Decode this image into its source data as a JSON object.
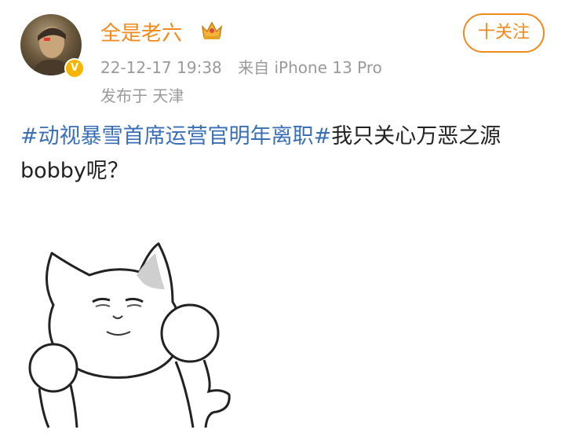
{
  "user": {
    "name": "全是老六",
    "verified_badge": "V",
    "verified_color": "#f7b500",
    "name_color": "#f08a1c",
    "crown_icon": "crown-icon"
  },
  "post_meta": {
    "time": "22-12-17 19:38",
    "source": "来自 iPhone 13 Pro",
    "location": "发布于 天津"
  },
  "follow_button": {
    "label": "十关注"
  },
  "post": {
    "topic": "#动视暴雪首席运营官明年离职#",
    "topic_color": "#3a6fb8",
    "text": "我只关心万恶之源bobby呢？"
  },
  "sticker": {
    "icon": "cat-meme-sticker"
  }
}
